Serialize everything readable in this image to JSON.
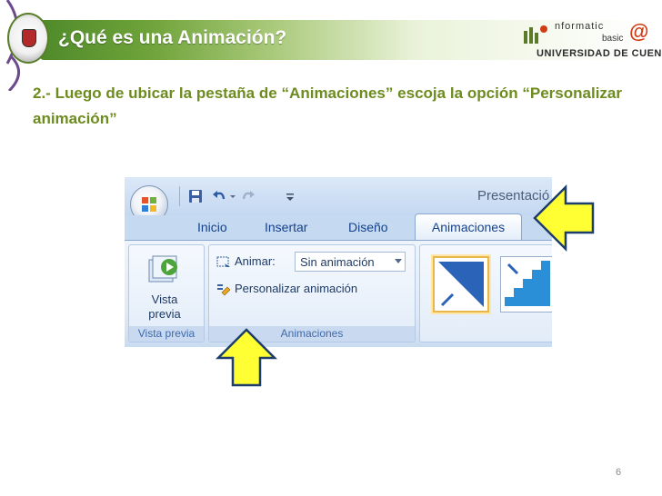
{
  "slide": {
    "title": "¿Qué es una Animación?",
    "body": "2.- Luego de ubicar la pestaña de “Animaciones”  escoja la opción “Personalizar animación”",
    "page_number": "6",
    "logo": {
      "line1": "nformatic",
      "line2": "basic",
      "at": "@",
      "line3": "UNIVERSIDAD DE CUENCA"
    },
    "colors": {
      "title_green": "#4f8a2a",
      "body_text": "#6d8b1e",
      "arrow_fill": "#ffff33"
    }
  },
  "office": {
    "window_title": "Presentació",
    "tabs": [
      "Inicio",
      "Insertar",
      "Diseño",
      "Animaciones"
    ],
    "active_tab": "Animaciones",
    "groups": {
      "preview": {
        "label_line1": "Vista",
        "label_line2": "previa",
        "group_label": "Vista previa"
      },
      "animations": {
        "animar_label": "Animar:",
        "animar_value": "Sin animación",
        "custom_label": "Personalizar animación",
        "group_label": "Animaciones"
      }
    },
    "quick_access_icons": [
      "save-icon",
      "undo-icon",
      "redo-icon",
      "customize-icon"
    ]
  }
}
